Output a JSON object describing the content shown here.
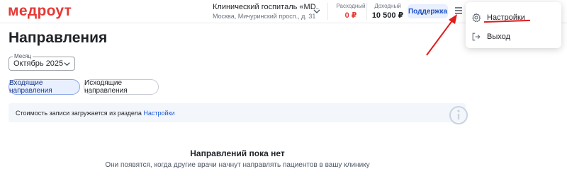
{
  "header": {
    "logo": "медроут",
    "clinic_name": "Клинический госпиталь «MD...",
    "clinic_address": "Москва, Мичуринский просп., д. 31",
    "expense_label": "Расходный",
    "expense_value": "0 ₽",
    "income_label": "Доходный",
    "income_value": "10 500 ₽",
    "support_label": "Поддержка"
  },
  "menu": {
    "items": [
      {
        "label": "Настройки",
        "icon": "gear-icon"
      },
      {
        "label": "Выход",
        "icon": "logout-icon"
      }
    ]
  },
  "page": {
    "title": "Направления",
    "month_legend": "Месяц",
    "month_value": "Октябрь 2025",
    "chips": [
      "Входящие направления",
      "Исходящие направления"
    ],
    "info_text": "Стоимость записи загружается из раздела ",
    "info_link": "Настройки",
    "empty_title": "Направлений пока нет",
    "empty_subtitle": "Они появятся, когда другие врачи начнут направлять пациентов в вашу клинику"
  },
  "colors": {
    "brand": "#e53935",
    "accent": "#1e5ad7",
    "expense": "#e53935",
    "annotation": "#e31b1b"
  }
}
